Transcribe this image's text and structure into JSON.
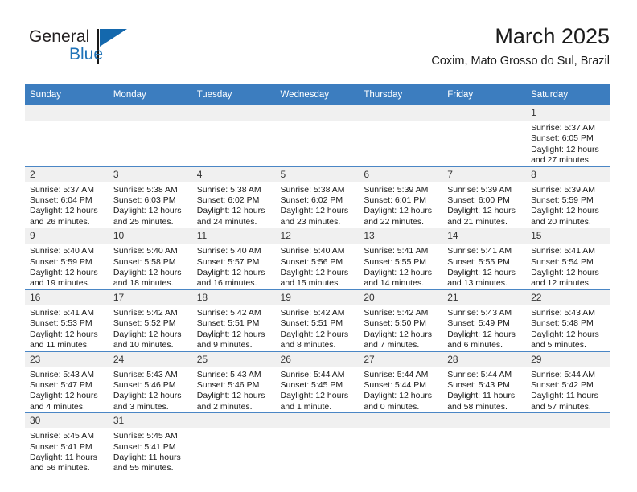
{
  "logo": {
    "word_one": "General",
    "word_two": "Blue",
    "icon": "flag-triangle-icon"
  },
  "header": {
    "title": "March 2025",
    "subtitle": "Coxim, Mato Grosso do Sul, Brazil"
  },
  "colors": {
    "header_blue": "#3c7dbf",
    "row_divider": "#4a86c5",
    "daynum_band": "#f0f0f0",
    "logo_blue": "#1f73b8"
  },
  "labels": {
    "sunrise": "Sunrise:",
    "sunset": "Sunset:",
    "daylight": "Daylight:"
  },
  "weekdays": [
    "Sunday",
    "Monday",
    "Tuesday",
    "Wednesday",
    "Thursday",
    "Friday",
    "Saturday"
  ],
  "weeks": [
    [
      {
        "day": "",
        "blank": true
      },
      {
        "day": "",
        "blank": true
      },
      {
        "day": "",
        "blank": true
      },
      {
        "day": "",
        "blank": true
      },
      {
        "day": "",
        "blank": true
      },
      {
        "day": "",
        "blank": true
      },
      {
        "day": "1",
        "sunrise": "Sunrise: 5:37 AM",
        "sunset": "Sunset: 6:05 PM",
        "daylight_1": "Daylight: 12 hours",
        "daylight_2": "and 27 minutes."
      }
    ],
    [
      {
        "day": "2",
        "sunrise": "Sunrise: 5:37 AM",
        "sunset": "Sunset: 6:04 PM",
        "daylight_1": "Daylight: 12 hours",
        "daylight_2": "and 26 minutes."
      },
      {
        "day": "3",
        "sunrise": "Sunrise: 5:38 AM",
        "sunset": "Sunset: 6:03 PM",
        "daylight_1": "Daylight: 12 hours",
        "daylight_2": "and 25 minutes."
      },
      {
        "day": "4",
        "sunrise": "Sunrise: 5:38 AM",
        "sunset": "Sunset: 6:02 PM",
        "daylight_1": "Daylight: 12 hours",
        "daylight_2": "and 24 minutes."
      },
      {
        "day": "5",
        "sunrise": "Sunrise: 5:38 AM",
        "sunset": "Sunset: 6:02 PM",
        "daylight_1": "Daylight: 12 hours",
        "daylight_2": "and 23 minutes."
      },
      {
        "day": "6",
        "sunrise": "Sunrise: 5:39 AM",
        "sunset": "Sunset: 6:01 PM",
        "daylight_1": "Daylight: 12 hours",
        "daylight_2": "and 22 minutes."
      },
      {
        "day": "7",
        "sunrise": "Sunrise: 5:39 AM",
        "sunset": "Sunset: 6:00 PM",
        "daylight_1": "Daylight: 12 hours",
        "daylight_2": "and 21 minutes."
      },
      {
        "day": "8",
        "sunrise": "Sunrise: 5:39 AM",
        "sunset": "Sunset: 5:59 PM",
        "daylight_1": "Daylight: 12 hours",
        "daylight_2": "and 20 minutes."
      }
    ],
    [
      {
        "day": "9",
        "sunrise": "Sunrise: 5:40 AM",
        "sunset": "Sunset: 5:59 PM",
        "daylight_1": "Daylight: 12 hours",
        "daylight_2": "and 19 minutes."
      },
      {
        "day": "10",
        "sunrise": "Sunrise: 5:40 AM",
        "sunset": "Sunset: 5:58 PM",
        "daylight_1": "Daylight: 12 hours",
        "daylight_2": "and 18 minutes."
      },
      {
        "day": "11",
        "sunrise": "Sunrise: 5:40 AM",
        "sunset": "Sunset: 5:57 PM",
        "daylight_1": "Daylight: 12 hours",
        "daylight_2": "and 16 minutes."
      },
      {
        "day": "12",
        "sunrise": "Sunrise: 5:40 AM",
        "sunset": "Sunset: 5:56 PM",
        "daylight_1": "Daylight: 12 hours",
        "daylight_2": "and 15 minutes."
      },
      {
        "day": "13",
        "sunrise": "Sunrise: 5:41 AM",
        "sunset": "Sunset: 5:55 PM",
        "daylight_1": "Daylight: 12 hours",
        "daylight_2": "and 14 minutes."
      },
      {
        "day": "14",
        "sunrise": "Sunrise: 5:41 AM",
        "sunset": "Sunset: 5:55 PM",
        "daylight_1": "Daylight: 12 hours",
        "daylight_2": "and 13 minutes."
      },
      {
        "day": "15",
        "sunrise": "Sunrise: 5:41 AM",
        "sunset": "Sunset: 5:54 PM",
        "daylight_1": "Daylight: 12 hours",
        "daylight_2": "and 12 minutes."
      }
    ],
    [
      {
        "day": "16",
        "sunrise": "Sunrise: 5:41 AM",
        "sunset": "Sunset: 5:53 PM",
        "daylight_1": "Daylight: 12 hours",
        "daylight_2": "and 11 minutes."
      },
      {
        "day": "17",
        "sunrise": "Sunrise: 5:42 AM",
        "sunset": "Sunset: 5:52 PM",
        "daylight_1": "Daylight: 12 hours",
        "daylight_2": "and 10 minutes."
      },
      {
        "day": "18",
        "sunrise": "Sunrise: 5:42 AM",
        "sunset": "Sunset: 5:51 PM",
        "daylight_1": "Daylight: 12 hours",
        "daylight_2": "and 9 minutes."
      },
      {
        "day": "19",
        "sunrise": "Sunrise: 5:42 AM",
        "sunset": "Sunset: 5:51 PM",
        "daylight_1": "Daylight: 12 hours",
        "daylight_2": "and 8 minutes."
      },
      {
        "day": "20",
        "sunrise": "Sunrise: 5:42 AM",
        "sunset": "Sunset: 5:50 PM",
        "daylight_1": "Daylight: 12 hours",
        "daylight_2": "and 7 minutes."
      },
      {
        "day": "21",
        "sunrise": "Sunrise: 5:43 AM",
        "sunset": "Sunset: 5:49 PM",
        "daylight_1": "Daylight: 12 hours",
        "daylight_2": "and 6 minutes."
      },
      {
        "day": "22",
        "sunrise": "Sunrise: 5:43 AM",
        "sunset": "Sunset: 5:48 PM",
        "daylight_1": "Daylight: 12 hours",
        "daylight_2": "and 5 minutes."
      }
    ],
    [
      {
        "day": "23",
        "sunrise": "Sunrise: 5:43 AM",
        "sunset": "Sunset: 5:47 PM",
        "daylight_1": "Daylight: 12 hours",
        "daylight_2": "and 4 minutes."
      },
      {
        "day": "24",
        "sunrise": "Sunrise: 5:43 AM",
        "sunset": "Sunset: 5:46 PM",
        "daylight_1": "Daylight: 12 hours",
        "daylight_2": "and 3 minutes."
      },
      {
        "day": "25",
        "sunrise": "Sunrise: 5:43 AM",
        "sunset": "Sunset: 5:46 PM",
        "daylight_1": "Daylight: 12 hours",
        "daylight_2": "and 2 minutes."
      },
      {
        "day": "26",
        "sunrise": "Sunrise: 5:44 AM",
        "sunset": "Sunset: 5:45 PM",
        "daylight_1": "Daylight: 12 hours",
        "daylight_2": "and 1 minute."
      },
      {
        "day": "27",
        "sunrise": "Sunrise: 5:44 AM",
        "sunset": "Sunset: 5:44 PM",
        "daylight_1": "Daylight: 12 hours",
        "daylight_2": "and 0 minutes."
      },
      {
        "day": "28",
        "sunrise": "Sunrise: 5:44 AM",
        "sunset": "Sunset: 5:43 PM",
        "daylight_1": "Daylight: 11 hours",
        "daylight_2": "and 58 minutes."
      },
      {
        "day": "29",
        "sunrise": "Sunrise: 5:44 AM",
        "sunset": "Sunset: 5:42 PM",
        "daylight_1": "Daylight: 11 hours",
        "daylight_2": "and 57 minutes."
      }
    ],
    [
      {
        "day": "30",
        "sunrise": "Sunrise: 5:45 AM",
        "sunset": "Sunset: 5:41 PM",
        "daylight_1": "Daylight: 11 hours",
        "daylight_2": "and 56 minutes."
      },
      {
        "day": "31",
        "sunrise": "Sunrise: 5:45 AM",
        "sunset": "Sunset: 5:41 PM",
        "daylight_1": "Daylight: 11 hours",
        "daylight_2": "and 55 minutes."
      },
      {
        "day": "",
        "blank": true
      },
      {
        "day": "",
        "blank": true
      },
      {
        "day": "",
        "blank": true
      },
      {
        "day": "",
        "blank": true
      },
      {
        "day": "",
        "blank": true
      }
    ]
  ]
}
